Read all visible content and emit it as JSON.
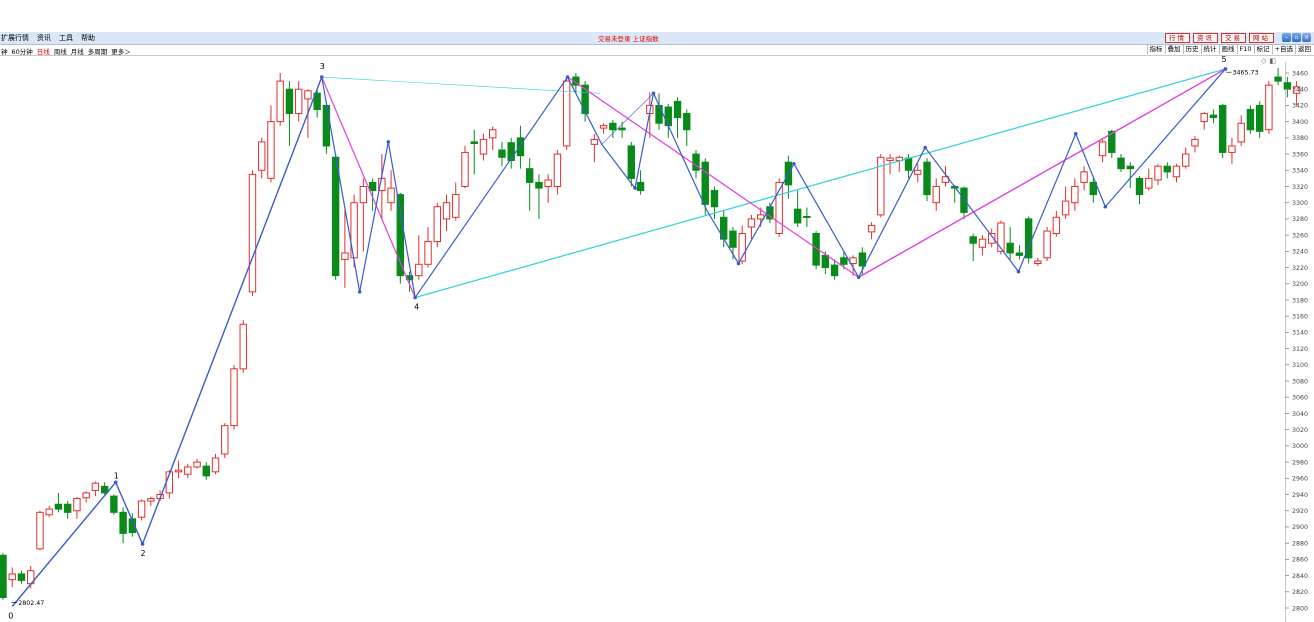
{
  "menu": [
    {
      "label": "扩展行情"
    },
    {
      "label": "资讯"
    },
    {
      "label": "工具"
    },
    {
      "label": "帮助"
    }
  ],
  "window_title": "交易未登录 上证指数",
  "top_buttons": [
    {
      "label": "行情"
    },
    {
      "label": "资讯"
    },
    {
      "label": "交易"
    },
    {
      "label": "网站"
    }
  ],
  "window_controls": {
    "minimize": "–",
    "restore": "▫",
    "close": "×"
  },
  "periods": [
    {
      "label": "钟"
    },
    {
      "label": "60分钟"
    },
    {
      "label": "日线",
      "active": true
    },
    {
      "label": "周线"
    },
    {
      "label": "月线"
    },
    {
      "label": "多周期"
    },
    {
      "label": "更多＞"
    }
  ],
  "tools": [
    {
      "label": "指标"
    },
    {
      "label": "叠加"
    },
    {
      "label": "历史"
    },
    {
      "label": "统计"
    },
    {
      "label": "画线"
    },
    {
      "label": "F10"
    },
    {
      "label": "标记"
    },
    {
      "label": "+自选"
    },
    {
      "label": "返回"
    }
  ],
  "toggle_icons": {
    "diamond": "◇",
    "panel": "◧"
  },
  "colors": {
    "up": "#e03030",
    "down": "#0a8a1a",
    "wave_blue": "#3a5ccc",
    "wave_magenta": "#e040e0",
    "wave_cyan": "#30d0d8",
    "axis_text": "#444444"
  },
  "chart_data": {
    "type": "candlestick",
    "y_ticks": [
      2800,
      2820,
      2840,
      2860,
      2880,
      2900,
      2920,
      2940,
      2960,
      2980,
      3000,
      3020,
      3040,
      3060,
      3080,
      3100,
      3120,
      3140,
      3160,
      3180,
      3200,
      3220,
      3240,
      3260,
      3280,
      3300,
      3320,
      3340,
      3360,
      3380,
      3400,
      3420,
      3440,
      3460
    ],
    "ylim": [
      2788,
      3480
    ],
    "high_label": "3465.73",
    "low_label": "2802.47",
    "candles": [
      [
        2865,
        2813,
        2868,
        2810
      ],
      [
        2835,
        2842,
        2850,
        2826
      ],
      [
        2842,
        2834,
        2846,
        2830
      ],
      [
        2830,
        2846,
        2852,
        2824
      ],
      [
        2873,
        2918,
        2920,
        2871
      ],
      [
        2915,
        2922,
        2926,
        2912
      ],
      [
        2928,
        2922,
        2942,
        2918
      ],
      [
        2928,
        2918,
        2932,
        2910
      ],
      [
        2920,
        2935,
        2937,
        2910
      ],
      [
        2936,
        2942,
        2944,
        2930
      ],
      [
        2945,
        2954,
        2956,
        2938
      ],
      [
        2950,
        2942,
        2955,
        2940
      ],
      [
        2938,
        2918,
        2940,
        2915
      ],
      [
        2918,
        2892,
        2924,
        2880
      ],
      [
        2910,
        2893,
        2917,
        2888
      ],
      [
        2912,
        2932,
        2934,
        2908
      ],
      [
        2932,
        2935,
        2937,
        2926
      ],
      [
        2935,
        2940,
        2945,
        2932
      ],
      [
        2942,
        2968,
        2970,
        2935
      ],
      [
        2968,
        2970,
        2982,
        2960
      ],
      [
        2965,
        2974,
        2978,
        2960
      ],
      [
        2974,
        2980,
        2984,
        2972
      ],
      [
        2975,
        2963,
        2980,
        2958
      ],
      [
        2968,
        2985,
        2990,
        2965
      ],
      [
        2990,
        3025,
        3028,
        2985
      ],
      [
        3025,
        3095,
        3100,
        3020
      ],
      [
        3095,
        3150,
        3155,
        3090
      ],
      [
        3190,
        3335,
        3340,
        3185
      ],
      [
        3340,
        3375,
        3380,
        3330
      ],
      [
        3330,
        3400,
        3420,
        3325
      ],
      [
        3400,
        3450,
        3460,
        3395
      ],
      [
        3440,
        3410,
        3450,
        3370
      ],
      [
        3410,
        3440,
        3450,
        3400
      ],
      [
        3428,
        3438,
        3440,
        3380
      ],
      [
        3435,
        3415,
        3440,
        3405
      ],
      [
        3420,
        3370,
        3425,
        3360
      ],
      [
        3356,
        3210,
        3360,
        3205
      ],
      [
        3230,
        3238,
        3290,
        3195
      ],
      [
        3232,
        3300,
        3310,
        3220
      ],
      [
        3300,
        3320,
        3330,
        3240
      ],
      [
        3325,
        3315,
        3330,
        3290
      ],
      [
        3315,
        3330,
        3360,
        3280
      ],
      [
        3300,
        3318,
        3340,
        3290
      ],
      [
        3310,
        3210,
        3312,
        3200
      ],
      [
        3210,
        3205,
        3215,
        3190
      ],
      [
        3210,
        3224,
        3260,
        3205
      ],
      [
        3224,
        3252,
        3270,
        3220
      ],
      [
        3252,
        3295,
        3300,
        3245
      ],
      [
        3280,
        3300,
        3310,
        3265
      ],
      [
        3282,
        3310,
        3325,
        3278
      ],
      [
        3320,
        3362,
        3370,
        3318
      ],
      [
        3375,
        3373,
        3390,
        3335
      ],
      [
        3360,
        3378,
        3385,
        3352
      ],
      [
        3380,
        3390,
        3394,
        3365
      ],
      [
        3365,
        3356,
        3375,
        3345
      ],
      [
        3374,
        3352,
        3380,
        3342
      ],
      [
        3380,
        3358,
        3395,
        3342
      ],
      [
        3342,
        3325,
        3355,
        3290
      ],
      [
        3325,
        3318,
        3335,
        3280
      ],
      [
        3320,
        3328,
        3335,
        3300
      ],
      [
        3320,
        3360,
        3365,
        3310
      ],
      [
        3370,
        3450,
        3455,
        3365
      ],
      [
        3455,
        3445,
        3460,
        3435
      ],
      [
        3445,
        3410,
        3450,
        3400
      ],
      [
        3372,
        3378,
        3385,
        3350
      ],
      [
        3392,
        3395,
        3398,
        3385
      ],
      [
        3398,
        3390,
        3402,
        3380
      ],
      [
        3392,
        3390,
        3400,
        3380
      ],
      [
        3370,
        3330,
        3375,
        3320
      ],
      [
        3325,
        3315,
        3340,
        3310
      ],
      [
        3410,
        3420,
        3436,
        3380
      ],
      [
        3420,
        3398,
        3435,
        3390
      ],
      [
        3418,
        3395,
        3422,
        3380
      ],
      [
        3425,
        3405,
        3430,
        3380
      ],
      [
        3410,
        3390,
        3415,
        3370
      ],
      [
        3360,
        3340,
        3365,
        3330
      ],
      [
        3350,
        3298,
        3355,
        3285
      ],
      [
        3315,
        3295,
        3320,
        3280
      ],
      [
        3282,
        3255,
        3290,
        3245
      ],
      [
        3265,
        3245,
        3270,
        3230
      ],
      [
        3228,
        3262,
        3272,
        3224
      ],
      [
        3270,
        3280,
        3285,
        3255
      ],
      [
        3280,
        3285,
        3294,
        3270
      ],
      [
        3295,
        3280,
        3300,
        3275
      ],
      [
        3262,
        3325,
        3330,
        3258
      ],
      [
        3350,
        3322,
        3358,
        3305
      ],
      [
        3292,
        3275,
        3315,
        3270
      ],
      [
        3283,
        3282,
        3294,
        3270
      ],
      [
        3262,
        3223,
        3265,
        3218
      ],
      [
        3235,
        3220,
        3240,
        3212
      ],
      [
        3223,
        3210,
        3230,
        3205
      ],
      [
        3232,
        3224,
        3240,
        3218
      ],
      [
        3225,
        3232,
        3235,
        3210
      ],
      [
        3238,
        3222,
        3245,
        3210
      ],
      [
        3264,
        3272,
        3276,
        3255
      ],
      [
        3285,
        3356,
        3360,
        3282
      ],
      [
        3352,
        3355,
        3360,
        3335
      ],
      [
        3352,
        3356,
        3358,
        3338
      ],
      [
        3355,
        3340,
        3360,
        3330
      ],
      [
        3335,
        3340,
        3348,
        3325
      ],
      [
        3350,
        3310,
        3355,
        3302
      ],
      [
        3300,
        3320,
        3330,
        3290
      ],
      [
        3325,
        3332,
        3345,
        3320
      ],
      [
        3320,
        3318,
        3322,
        3300
      ],
      [
        3318,
        3288,
        3320,
        3280
      ],
      [
        3258,
        3250,
        3262,
        3228
      ],
      [
        3245,
        3255,
        3260,
        3235
      ],
      [
        3250,
        3262,
        3268,
        3245
      ],
      [
        3240,
        3275,
        3278,
        3236
      ],
      [
        3250,
        3238,
        3270,
        3230
      ],
      [
        3238,
        3235,
        3248,
        3230
      ],
      [
        3280,
        3232,
        3283,
        3225
      ],
      [
        3225,
        3228,
        3232,
        3222
      ],
      [
        3232,
        3265,
        3270,
        3228
      ],
      [
        3262,
        3282,
        3290,
        3258
      ],
      [
        3285,
        3302,
        3320,
        3280
      ],
      [
        3300,
        3320,
        3330,
        3290
      ],
      [
        3325,
        3338,
        3345,
        3315
      ],
      [
        3325,
        3310,
        3330,
        3300
      ],
      [
        3358,
        3375,
        3378,
        3350
      ],
      [
        3388,
        3362,
        3390,
        3355
      ],
      [
        3355,
        3342,
        3360,
        3338
      ],
      [
        3345,
        3342,
        3350,
        3318
      ],
      [
        3330,
        3310,
        3333,
        3298
      ],
      [
        3318,
        3330,
        3342,
        3315
      ],
      [
        3328,
        3345,
        3348,
        3322
      ],
      [
        3345,
        3338,
        3350,
        3330
      ],
      [
        3332,
        3345,
        3348,
        3325
      ],
      [
        3345,
        3360,
        3368,
        3342
      ],
      [
        3370,
        3378,
        3382,
        3362
      ],
      [
        3400,
        3410,
        3412,
        3390
      ],
      [
        3408,
        3405,
        3415,
        3398
      ],
      [
        3420,
        3362,
        3422,
        3355
      ],
      [
        3362,
        3370,
        3380,
        3348
      ],
      [
        3375,
        3398,
        3408,
        3370
      ],
      [
        3415,
        3390,
        3420,
        3385
      ],
      [
        3420,
        3388,
        3425,
        3380
      ],
      [
        3390,
        3445,
        3450,
        3385
      ],
      [
        3455,
        3450,
        3466,
        3445
      ],
      [
        3448,
        3440,
        3455,
        3430
      ],
      [
        3435,
        3443,
        3450,
        3420
      ]
    ]
  },
  "waves": [
    {
      "label": "0",
      "price": 2802
    },
    {
      "label": "1",
      "price": 2955
    },
    {
      "label": "2",
      "price": 2879
    },
    {
      "label": "3",
      "price": 3455
    },
    {
      "label": "4",
      "price": 3183
    },
    {
      "label": "5",
      "price": 3465
    }
  ]
}
